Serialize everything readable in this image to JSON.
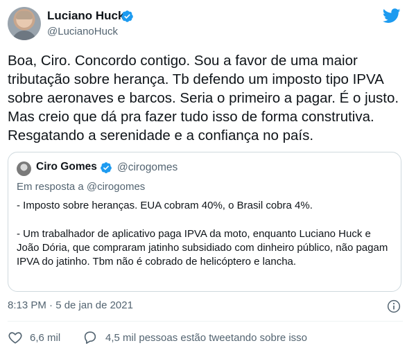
{
  "author": {
    "name": "Luciano Huck",
    "handle": "@LucianoHuck"
  },
  "tweet": {
    "text": "Boa, Ciro. Concordo contigo. Sou a favor de uma maior tributação sobre herança. Tb defendo um imposto tipo IPVA sobre aeronaves e barcos. Seria o primeiro a pagar. É o justo. Mas creio que dá pra fazer tudo isso de forma construtiva. Resgatando a serenidade e a confiança no país.",
    "timestamp": "8:13 PM · 5 de jan de 2021"
  },
  "quoted": {
    "name": "Ciro Gomes",
    "handle": "@cirogomes",
    "reply_to": "Em resposta a @cirogomes",
    "line1": "- Imposto sobre heranças. EUA cobram 40%, o Brasil cobra 4%.",
    "para2": "- Um trabalhador de aplicativo paga IPVA da moto, enquanto Luciano Huck e João Dória, que compraram jatinho subsidiado com dinheiro público, não pagam IPVA do jatinho. Tbm não é cobrado de helicóptero e lancha."
  },
  "actions": {
    "likes": "6,6 mil",
    "talking": "4,5 mil pessoas estão tweetando sobre isso"
  },
  "icons": {
    "verified": "verified-badge-icon",
    "logo": "twitter-bird-icon",
    "info": "info-icon",
    "like": "heart-icon",
    "talk": "comment-icon"
  },
  "colors": {
    "accent": "#1d9bf0",
    "secondary_text": "#536471",
    "border": "#cfd9de"
  }
}
